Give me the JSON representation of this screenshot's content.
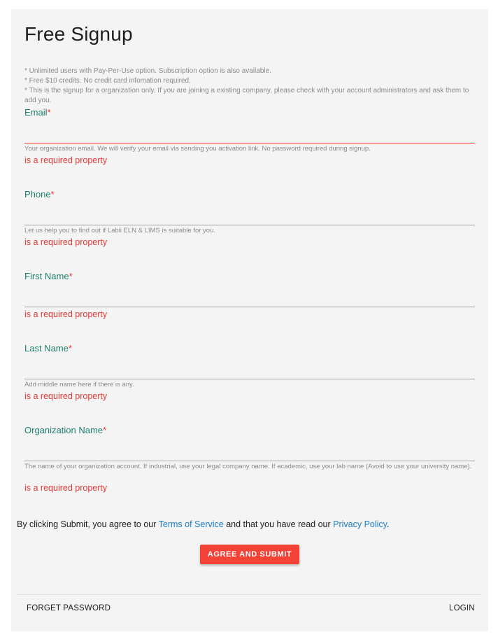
{
  "title": "Free Signup",
  "notes": [
    "* Unlimited users with Pay-Per-Use option. Subscription option is also available.",
    "* Free $10 credits. No credit card infomation required.",
    "* This is the signup for a organization only. If you are joining a existing company, please check with your account administrators and ask them to add you."
  ],
  "required_marker": "*",
  "error_text": "is a required property",
  "fields": {
    "email": {
      "label": "Email",
      "help": "Your organization email. We will verify your email via sending you activation link. No password required during signup.",
      "value": ""
    },
    "phone": {
      "label": "Phone",
      "help": "Let us help you to find out if Labii ELN & LIMS is suitable for you.",
      "value": ""
    },
    "first_name": {
      "label": "First Name",
      "help": "",
      "value": ""
    },
    "last_name": {
      "label": "Last Name",
      "help": "Add middle name here if there is any.",
      "value": ""
    },
    "organization_name": {
      "label": "Organization Name",
      "help": "The name of your organization account. If industrial, use your legal company name. If academic, use your lab name (Avoid to use your university name).",
      "value": ""
    }
  },
  "terms": {
    "prefix": "By clicking Submit, you agree to our ",
    "terms_link": "Terms of Service",
    "middle": " and that you have read our ",
    "privacy_link": "Privacy Policy",
    "suffix": "."
  },
  "submit_label": "AGREE AND SUBMIT",
  "footer": {
    "forget_password": "FORGET PASSWORD",
    "login": "LOGIN"
  },
  "colors": {
    "accent": "#f44336",
    "label": "#1e7e6b",
    "link": "#1a7fc9",
    "card_bg": "#f4f4f4"
  }
}
